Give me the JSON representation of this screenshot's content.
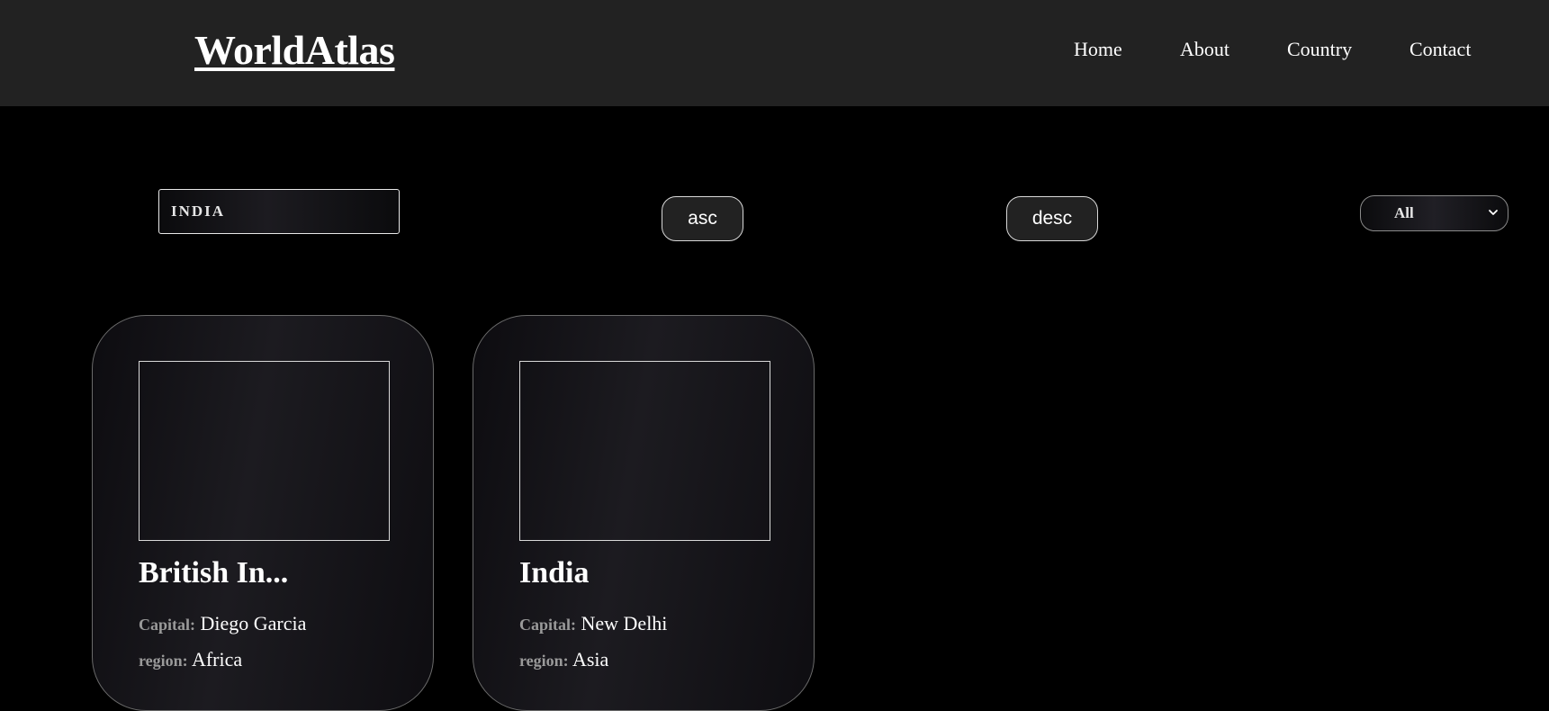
{
  "header": {
    "logo": "WorldAtlas",
    "nav": [
      "Home",
      "About",
      "Country",
      "Contact"
    ]
  },
  "controls": {
    "search_value": "INDIA",
    "asc_label": "asc",
    "desc_label": "desc",
    "region_filter": "All"
  },
  "cards": [
    {
      "name": "British In...",
      "capital_label": "Capital:",
      "capital": "Diego Garcia",
      "region_label": "region:",
      "region": "Africa"
    },
    {
      "name": "India",
      "capital_label": "Capital:",
      "capital": "New Delhi",
      "region_label": "region:",
      "region": "Asia"
    }
  ],
  "colors": {
    "header_bg": "#222222",
    "page_bg": "#000000",
    "text": "#ffffff",
    "label_gray": "#9a9a9a"
  }
}
